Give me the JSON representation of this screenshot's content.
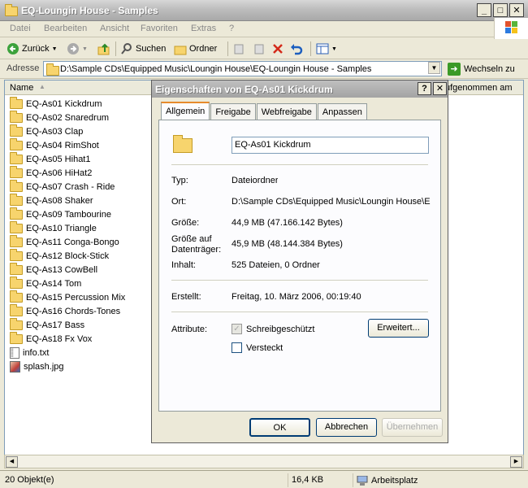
{
  "window": {
    "title": "EQ-Loungin House - Samples"
  },
  "menu": [
    "Datei",
    "Bearbeiten",
    "Ansicht",
    "Favoriten",
    "Extras",
    "?"
  ],
  "toolbar": {
    "back": "Zurück",
    "search": "Suchen",
    "folders": "Ordner"
  },
  "address": {
    "label": "Adresse",
    "path": "D:\\Sample CDs\\Equipped Music\\Loungin House\\EQ-Loungin House - Samples",
    "go": "Wechseln zu"
  },
  "list": {
    "col_name": "Name",
    "col_added": "ufgenommen am",
    "items": [
      {
        "name": "EQ-As01 Kickdrum",
        "type": "folder"
      },
      {
        "name": "EQ-As02 Snaredrum",
        "type": "folder"
      },
      {
        "name": "EQ-As03 Clap",
        "type": "folder"
      },
      {
        "name": "EQ-As04 RimShot",
        "type": "folder"
      },
      {
        "name": "EQ-As05 Hihat1",
        "type": "folder"
      },
      {
        "name": "EQ-As06 HiHat2",
        "type": "folder"
      },
      {
        "name": "EQ-As07 Crash - Ride",
        "type": "folder"
      },
      {
        "name": "EQ-As08 Shaker",
        "type": "folder"
      },
      {
        "name": "EQ-As09 Tambourine",
        "type": "folder"
      },
      {
        "name": "EQ-As10 Triangle",
        "type": "folder"
      },
      {
        "name": "EQ-As11 Conga-Bongo",
        "type": "folder"
      },
      {
        "name": "EQ-As12 Block-Stick",
        "type": "folder"
      },
      {
        "name": "EQ-As13 CowBell",
        "type": "folder"
      },
      {
        "name": "EQ-As14 Tom",
        "type": "folder"
      },
      {
        "name": "EQ-As15 Percussion Mix",
        "type": "folder"
      },
      {
        "name": "EQ-As16 Chords-Tones",
        "type": "folder"
      },
      {
        "name": "EQ-As17 Bass",
        "type": "folder"
      },
      {
        "name": "EQ-As18 Fx Vox",
        "type": "folder"
      },
      {
        "name": "info.txt",
        "type": "text"
      },
      {
        "name": "splash.jpg",
        "type": "image"
      }
    ]
  },
  "status": {
    "count": "20 Objekt(e)",
    "size": "16,4 KB",
    "location": "Arbeitsplatz"
  },
  "dialog": {
    "title": "Eigenschaften von EQ-As01 Kickdrum",
    "tabs": [
      "Allgemein",
      "Freigabe",
      "Webfreigabe",
      "Anpassen"
    ],
    "name_value": "EQ-As01 Kickdrum",
    "type_label": "Typ:",
    "type_value": "Dateiordner",
    "location_label": "Ort:",
    "location_value": "D:\\Sample CDs\\Equipped Music\\Loungin House\\E",
    "size_label": "Größe:",
    "size_value": "44,9 MB (47.166.142 Bytes)",
    "disk_label": "Größe auf Datenträger:",
    "disk_value": "45,9 MB (48.144.384 Bytes)",
    "content_label": "Inhalt:",
    "content_value": "525 Dateien, 0 Ordner",
    "created_label": "Erstellt:",
    "created_value": "Freitag, 10. März 2006, 00:19:40",
    "attributes_label": "Attribute:",
    "readonly_label": "Schreibgeschützt",
    "hidden_label": "Versteckt",
    "advanced_button": "Erweitert...",
    "ok": "OK",
    "cancel": "Abbrechen",
    "apply": "Übernehmen"
  }
}
